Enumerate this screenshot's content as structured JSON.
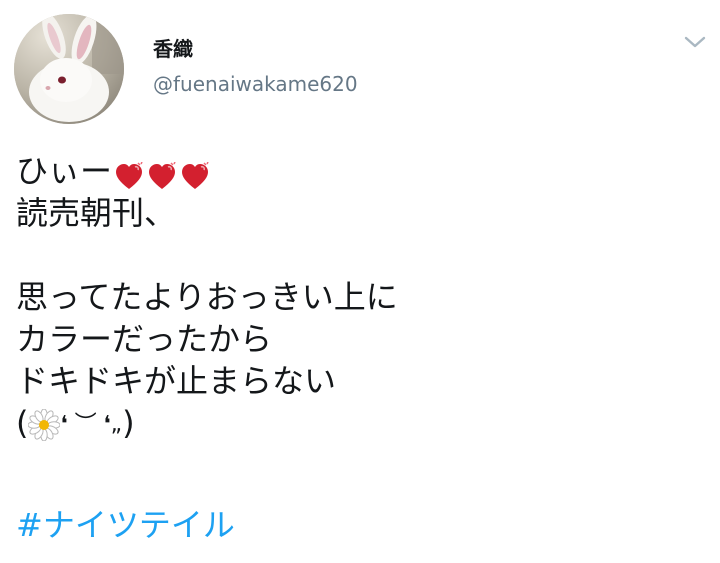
{
  "user": {
    "display_name": "香織",
    "handle": "@fuenaiwakame620",
    "avatar_icon": "white-rabbit-photo"
  },
  "menu": {
    "icon": "chevron-down-icon"
  },
  "tweet": {
    "line1_text": "ひぃー",
    "line1_emoji": "growing-heart-emoji",
    "line2": "読売朝刊、",
    "line4": "思ってたよりおっきい上に",
    "line5": "カラーだったから",
    "line6": "ドキドキが止まらない",
    "kaomoji_open": "(",
    "kaomoji_face": "❛ ︶ ❛",
    "kaomoji_mid": "„",
    "kaomoji_close": ")",
    "kaomoji_flower_icon": "daisy-icon",
    "hashtag": "#ナイツテイル"
  },
  "colors": {
    "link": "#1da1f2",
    "secondary_text": "#657786",
    "heart": "#d3202f"
  }
}
